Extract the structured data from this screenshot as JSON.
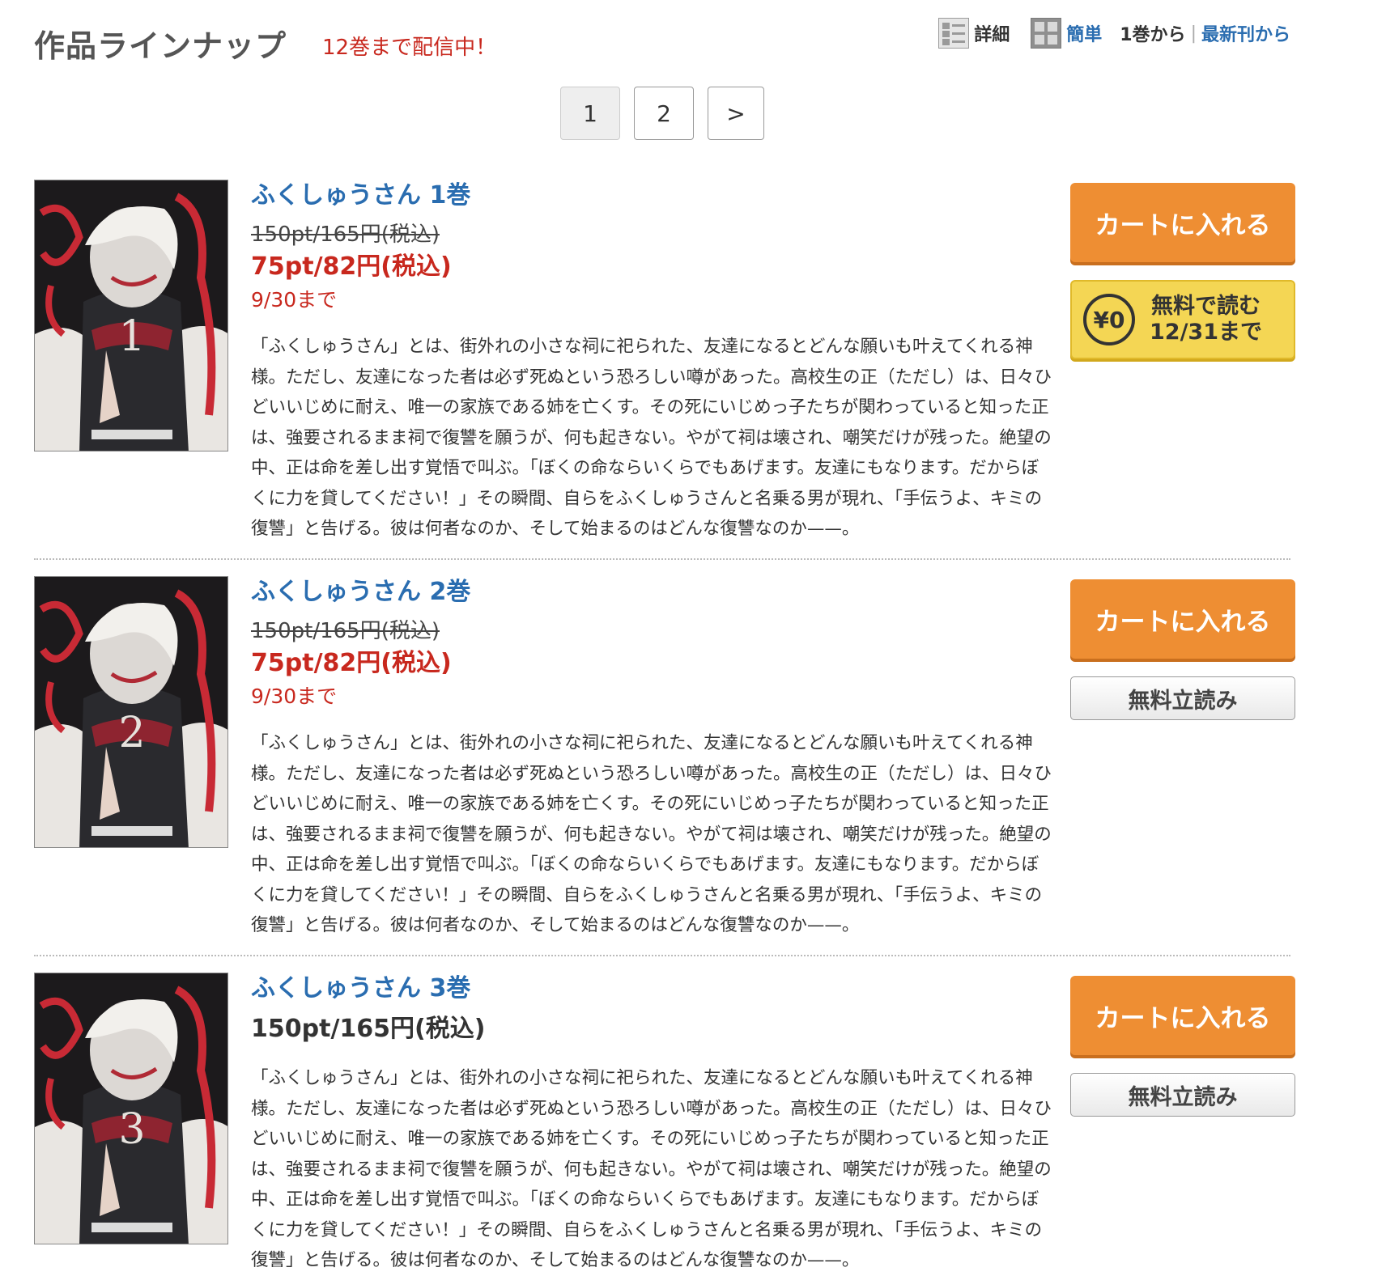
{
  "header": {
    "title": "作品ラインナップ",
    "notice": "12巻まで配信中！",
    "view_detail_label": "詳細",
    "view_simple_label": "簡単",
    "sort_first_label": "1巻から",
    "sort_separator": "|",
    "sort_latest_label": "最新刊から"
  },
  "pagination": {
    "current": "1",
    "page2": "2",
    "next": ">"
  },
  "items": [
    {
      "title": "ふくしゅうさん 1巻",
      "volume_mark": "1",
      "price_original": "150pt/165円(税込)",
      "price_sale": "75pt/82円(税込)",
      "sale_deadline": "9/30まで",
      "description": "「ふくしゅうさん」とは、街外れの小さな祠に祀られた、友達になるとどんな願いも叶えてくれる神様。ただし、友達になった者は必ず死ぬという恐ろしい噂があった。高校生の正（ただし）は、日々ひどいいじめに耐え、唯一の家族である姉を亡くす。その死にいじめっ子たちが関わっていると知った正は、強要されるまま祠で復讐を願うが、何も起きない。やがて祠は壊され、嘲笑だけが残った。絶望の中、正は命を差し出す覚悟で叫ぶ。「ぼくの命ならいくらでもあげます。友達にもなります。だからぼくに力を貸してください！」その瞬間、自らをふくしゅうさんと名乗る男が現れ、「手伝うよ、キミの復讐」と告げる。彼は何者なのか、そして始まるのはどんな復讐なのか——。",
      "cart_label": "カートに入れる",
      "free_badge": "¥0",
      "free_line1": "無料で読む",
      "free_line2": "12/31まで"
    },
    {
      "title": "ふくしゅうさん 2巻",
      "volume_mark": "2",
      "price_original": "150pt/165円(税込)",
      "price_sale": "75pt/82円(税込)",
      "sale_deadline": "9/30まで",
      "description": "「ふくしゅうさん」とは、街外れの小さな祠に祀られた、友達になるとどんな願いも叶えてくれる神様。ただし、友達になった者は必ず死ぬという恐ろしい噂があった。高校生の正（ただし）は、日々ひどいいじめに耐え、唯一の家族である姉を亡くす。その死にいじめっ子たちが関わっていると知った正は、強要されるまま祠で復讐を願うが、何も起きない。やがて祠は壊され、嘲笑だけが残った。絶望の中、正は命を差し出す覚悟で叫ぶ。「ぼくの命ならいくらでもあげます。友達にもなります。だからぼくに力を貸してください！」その瞬間、自らをふくしゅうさんと名乗る男が現れ、「手伝うよ、キミの復讐」と告げる。彼は何者なのか、そして始まるのはどんな復讐なのか——。",
      "cart_label": "カートに入れる",
      "tachiyomi_label": "無料立読み"
    },
    {
      "title": "ふくしゅうさん 3巻",
      "volume_mark": "3",
      "price": "150pt/165円(税込)",
      "description": "「ふくしゅうさん」とは、街外れの小さな祠に祀られた、友達になるとどんな願いも叶えてくれる神様。ただし、友達になった者は必ず死ぬという恐ろしい噂があった。高校生の正（ただし）は、日々ひどいいじめに耐え、唯一の家族である姉を亡くす。その死にいじめっ子たちが関わっていると知った正は、強要されるまま祠で復讐を願うが、何も起きない。やがて祠は壊され、嘲笑だけが残った。絶望の中、正は命を差し出す覚悟で叫ぶ。「ぼくの命ならいくらでもあげます。友達にもなります。だからぼくに力を貸してください！」その瞬間、自らをふくしゅうさんと名乗る男が現れ、「手伝うよ、キミの復讐」と告げる。彼は何者なのか、そして始まるのはどんな復讐なのか——。",
      "cart_label": "カートに入れる",
      "tachiyomi_label": "無料立読み"
    }
  ],
  "colors": {
    "accent_red": "#c8281e",
    "link_blue": "#2a6db0",
    "cart_orange": "#ee8e33",
    "free_yellow": "#f4d654"
  }
}
